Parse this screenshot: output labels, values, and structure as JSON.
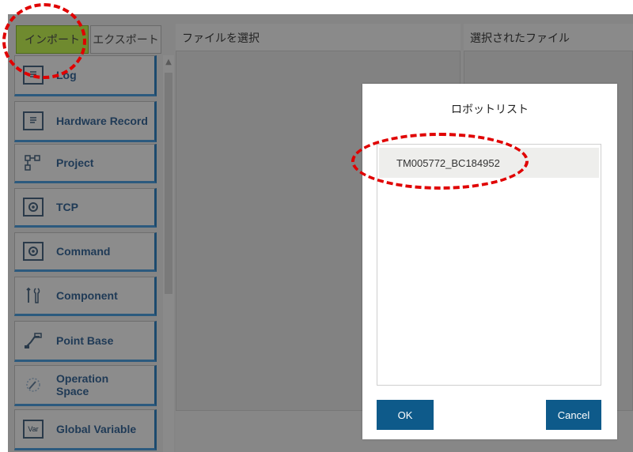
{
  "tabs": {
    "import_label": "インポート",
    "export_label": "エクスポート"
  },
  "sidebar": {
    "items": [
      {
        "label": "Log",
        "icon": "document-icon"
      },
      {
        "label": "Hardware Record",
        "icon": "document-icon"
      },
      {
        "label": "Project",
        "icon": "flow-icon"
      },
      {
        "label": "TCP",
        "icon": "gear-icon"
      },
      {
        "label": "Command",
        "icon": "gear-icon"
      },
      {
        "label": "Component",
        "icon": "tools-icon"
      },
      {
        "label": "Point Base",
        "icon": "robot-arm-icon"
      },
      {
        "label": "Operation Space",
        "icon": "space-icon"
      },
      {
        "label": "Global Variable",
        "icon": "var-icon"
      }
    ],
    "var_icon_text": "Var"
  },
  "panels": {
    "select_file": "ファイルを選択",
    "selected_file": "選択されたファイル"
  },
  "dialog": {
    "title": "ロボットリスト",
    "items": [
      "TM005772_BC184952"
    ],
    "ok_label": "OK",
    "cancel_label": "Cancel"
  },
  "colors": {
    "annotation": "#e00000",
    "button": "#0e5a8a",
    "import_tab": "#6f8a2f"
  }
}
